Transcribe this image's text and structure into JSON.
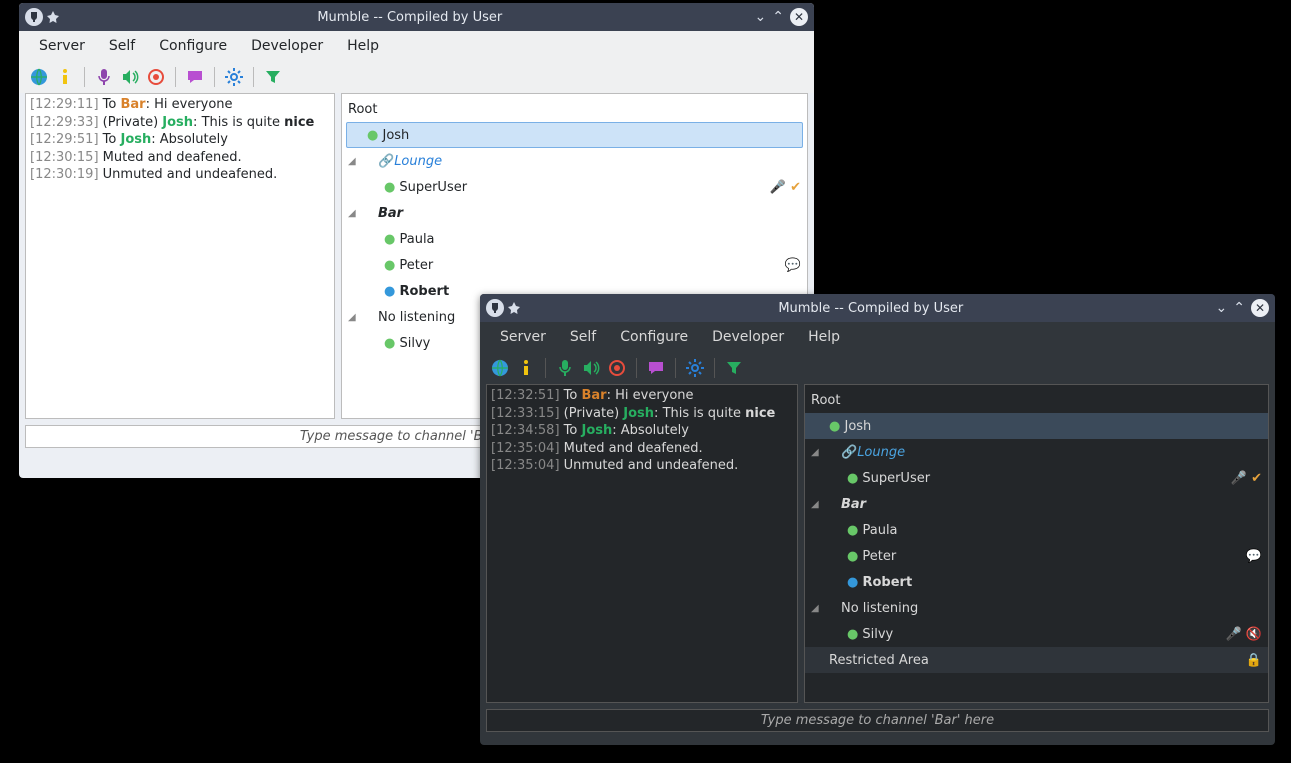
{
  "title": "Mumble -- Compiled by User",
  "menus": [
    "Server",
    "Self",
    "Configure",
    "Developer",
    "Help"
  ],
  "toolbar_icons": [
    "globe",
    "info",
    "mic",
    "speaker",
    "record",
    "chat",
    "gear",
    "filter"
  ],
  "light": {
    "chat": [
      {
        "ts": "[12:29:11]",
        "prefix": "To ",
        "who": "Bar",
        "who_cls": "name-bar",
        "sep": ": ",
        "msg": "Hi everyone"
      },
      {
        "ts": "[12:29:33]",
        "prefix": "(Private) ",
        "who": "Josh",
        "who_cls": "name-josh",
        "sep": ": ",
        "msg": "This is quite ",
        "bold": "nice"
      },
      {
        "ts": "[12:29:51]",
        "prefix": "To ",
        "who": "Josh",
        "who_cls": "name-josh",
        "sep": ": ",
        "msg": "Absolutely"
      },
      {
        "ts": "[12:30:15]",
        "prefix": "",
        "who": "",
        "who_cls": "",
        "sep": "",
        "msg": "Muted and deafened."
      },
      {
        "ts": "[12:30:19]",
        "prefix": "",
        "who": "",
        "who_cls": "",
        "sep": "",
        "msg": "Unmuted and undeafened."
      }
    ],
    "input_placeholder": "Type message to channel 'Bar' here"
  },
  "dark": {
    "chat": [
      {
        "ts": "[12:32:51]",
        "prefix": "To ",
        "who": "Bar",
        "who_cls": "name-bar",
        "sep": ": ",
        "msg": "Hi everyone"
      },
      {
        "ts": "[12:33:15]",
        "prefix": "(Private) ",
        "who": "Josh",
        "who_cls": "name-josh",
        "sep": ": ",
        "msg": "This is quite ",
        "bold": "nice"
      },
      {
        "ts": "[12:34:58]",
        "prefix": "To ",
        "who": "Josh",
        "who_cls": "name-josh",
        "sep": ": ",
        "msg": "Absolutely"
      },
      {
        "ts": "[12:35:04]",
        "prefix": "",
        "who": "",
        "who_cls": "",
        "sep": "",
        "msg": "Muted and deafened."
      },
      {
        "ts": "[12:35:04]",
        "prefix": "",
        "who": "",
        "who_cls": "",
        "sep": "",
        "msg": "Unmuted and undeafened."
      }
    ],
    "input_placeholder": "Type message to channel 'Bar' here"
  },
  "tree": {
    "root": "Root",
    "self_user": "Josh",
    "lounge": "Lounge",
    "superuser": "SuperUser",
    "bar": "Bar",
    "paula": "Paula",
    "peter": "Peter",
    "robert": "Robert",
    "no_listening": "No listening",
    "silvy": "Silvy",
    "restricted": "Restricted Area"
  }
}
